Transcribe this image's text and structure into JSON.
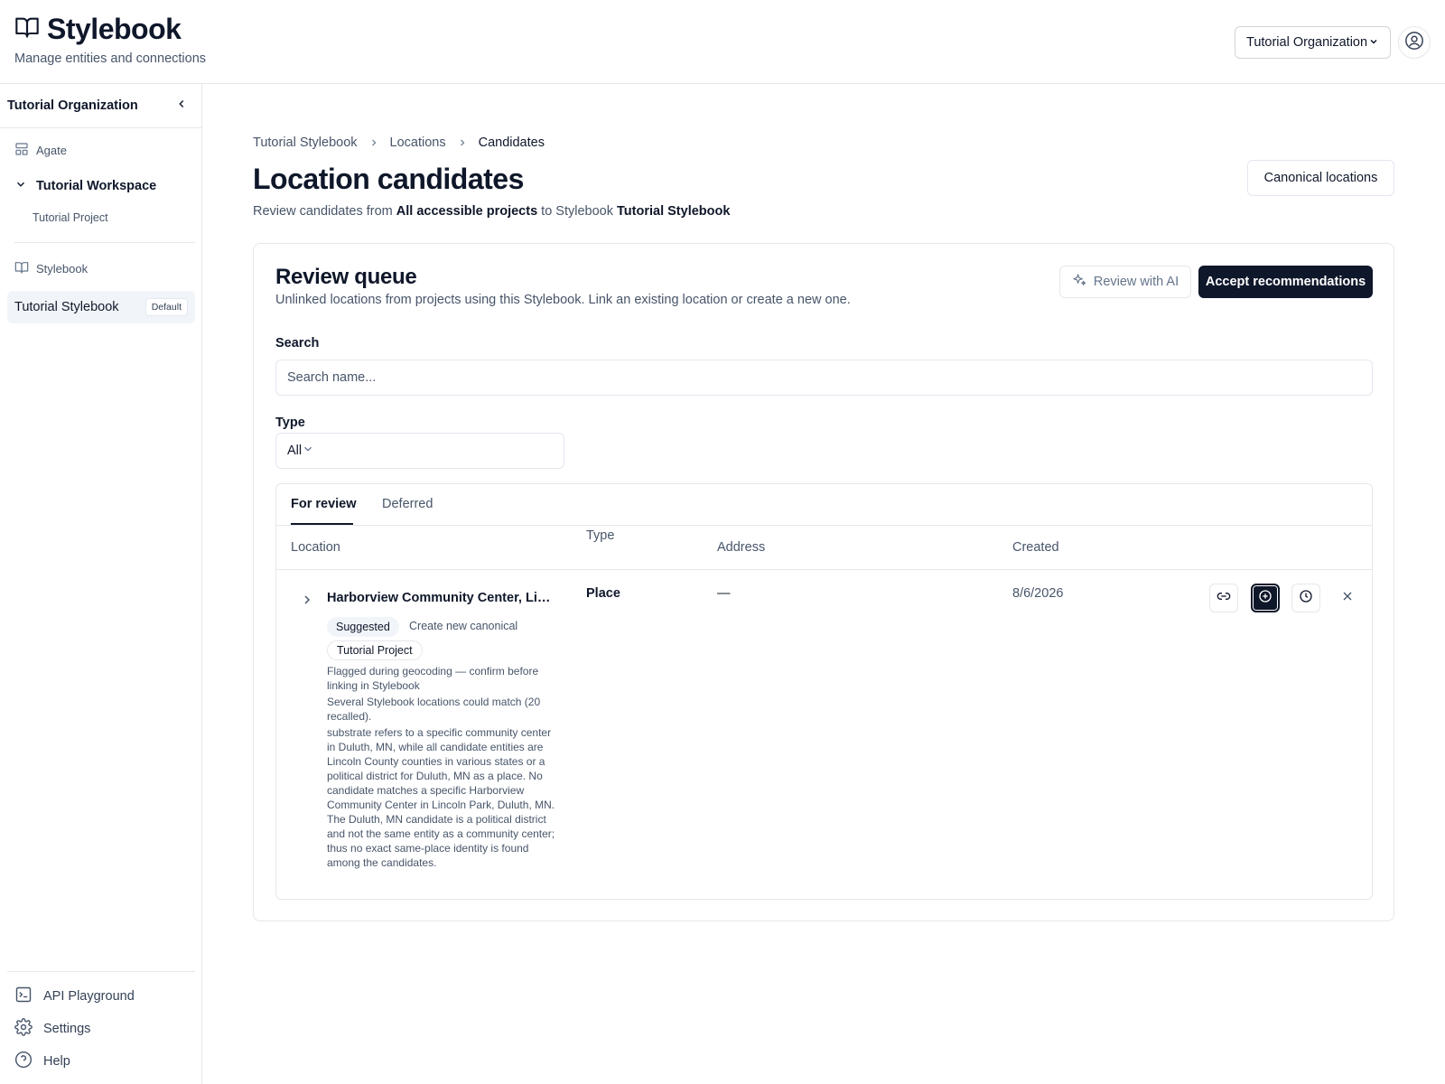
{
  "header": {
    "brand": "Stylebook",
    "subtitle": "Manage entities and connections",
    "org_select": "Tutorial Organization"
  },
  "sidebar": {
    "org": "Tutorial Organization",
    "agate": "Agate",
    "workspace": "Tutorial Workspace",
    "project": "Tutorial Project",
    "stylebook_section": "Stylebook",
    "active_stylebook": "Tutorial Stylebook",
    "default_badge": "Default",
    "footer": {
      "api": "API Playground",
      "settings": "Settings",
      "help": "Help"
    }
  },
  "breadcrumb": [
    "Tutorial Stylebook",
    "Locations",
    "Candidates"
  ],
  "page": {
    "title": "Location candidates",
    "sub_prefix": "Review candidates from",
    "sub_source": "All accessible projects",
    "sub_mid": "to Stylebook",
    "sub_target": "Tutorial Stylebook",
    "canonical_button": "Canonical locations"
  },
  "queue": {
    "title": "Review queue",
    "subtitle": "Unlinked locations from projects using this Stylebook. Link an existing location or create a new one.",
    "review_ai": "Review with AI",
    "accept": "Accept recommendations",
    "search_label": "Search",
    "search_placeholder": "Search name...",
    "type_label": "Type",
    "type_value": "All",
    "tabs": [
      "For review",
      "Deferred"
    ],
    "columns": [
      "Location",
      "Type",
      "Address",
      "Created"
    ],
    "rows": [
      {
        "name": "Harborview Community Center, Lincoln Park, Duluth, MN",
        "suggested_badge": "Suggested",
        "suggested_action": "Create new canonical",
        "project": "Tutorial Project",
        "warning": "Flagged during geocoding — confirm before linking in Stylebook",
        "match_note": "Several Stylebook locations could match (20 recalled).",
        "reason": "substrate refers to a specific community center in Duluth, MN, while all candidate entities are Lincoln County counties in various states or a political district for Duluth, MN as a place. No candidate matches a specific Harborview Community Center in Lincoln Park, Duluth, MN. The Duluth, MN candidate is a political district and not the same entity as a community center; thus no exact same-place identity is found among the candidates.",
        "type": "Place",
        "address": "—",
        "created": "8/6/2026"
      }
    ]
  },
  "colors": {
    "primary": "#0f172a",
    "muted": "#475569",
    "border": "#e5e7eb"
  }
}
